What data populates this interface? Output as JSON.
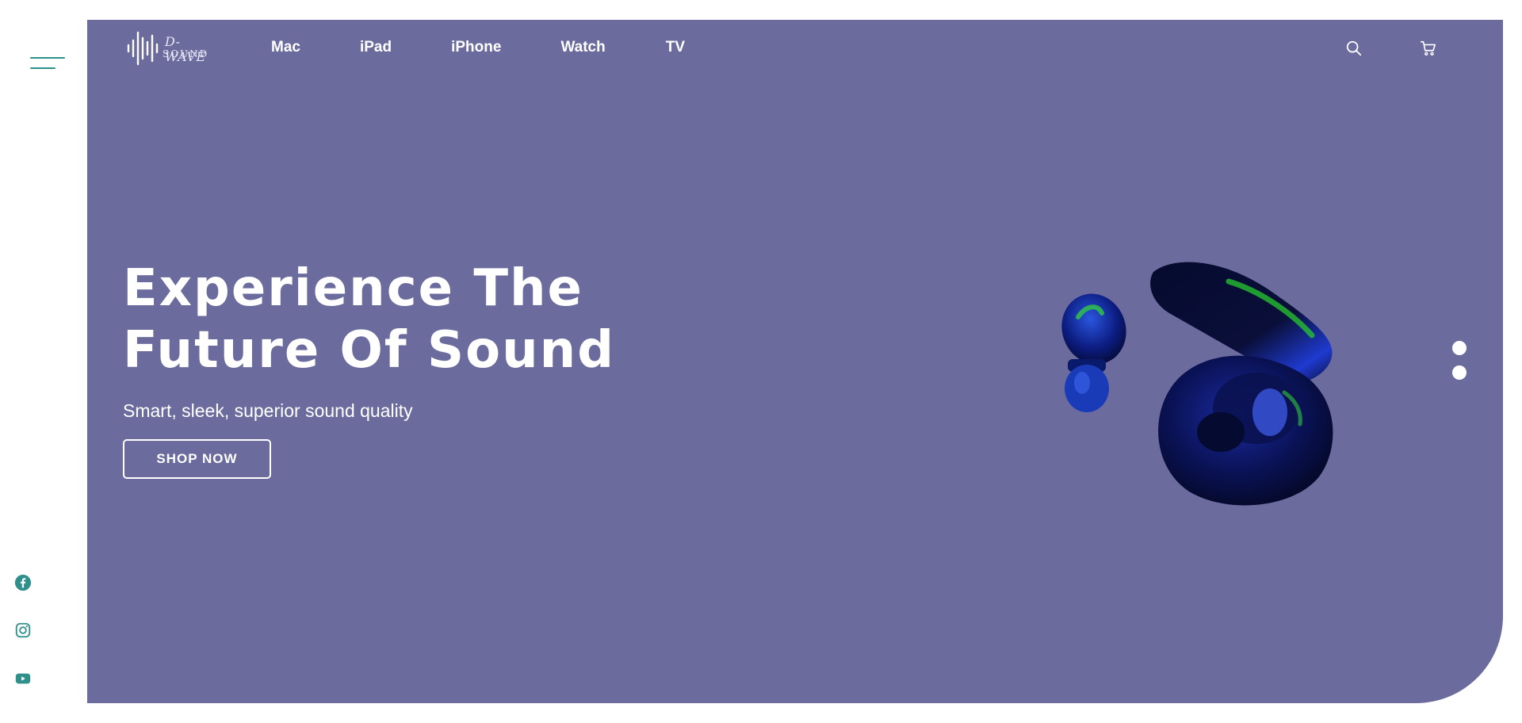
{
  "brand": {
    "logo_line1": "D-WAVE",
    "logo_line2": "SOUND"
  },
  "nav": {
    "links": [
      "Mac",
      "iPad",
      "iPhone",
      "Watch",
      "TV"
    ],
    "icons": [
      "search-icon",
      "cart-icon"
    ]
  },
  "hero": {
    "headline_line1": "Experience The",
    "headline_line2": "Future Of Sound",
    "subheadline": "Smart, sleek, superior sound quality",
    "cta_label": "SHOP NOW",
    "background_color": "#6b6b9e"
  },
  "sidebar": {
    "menu_icon": "hamburger-menu-icon",
    "social": [
      "facebook-icon",
      "instagram-icon",
      "youtube-icon"
    ],
    "accent_color": "#2f8f8a"
  },
  "carousel": {
    "slide_count": 2
  }
}
